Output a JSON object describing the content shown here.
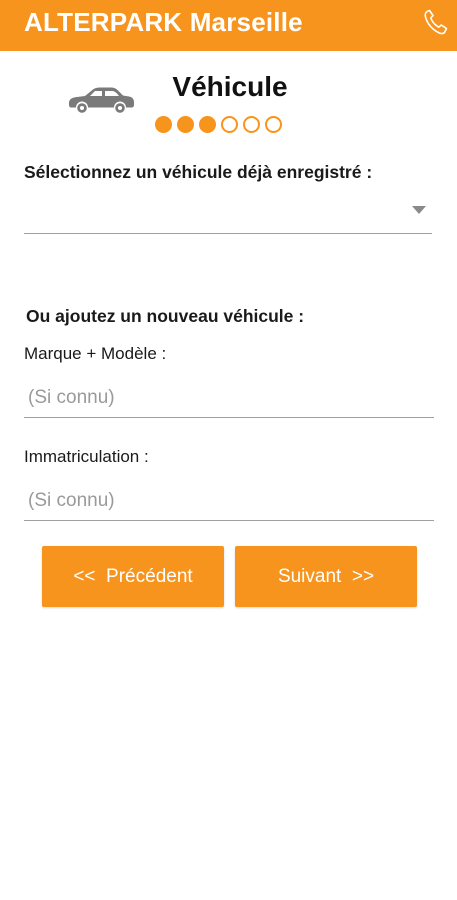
{
  "app": {
    "title": "ALTERPARK Marseille",
    "accent_color": "#f7941d",
    "phone_icon": "phone-icon"
  },
  "step": {
    "icon": "car-icon",
    "title": "Véhicule",
    "current": 3,
    "total": 6
  },
  "existing_vehicle": {
    "label": "Sélectionnez un véhicule déjà enregistré :",
    "selected_value": ""
  },
  "new_vehicle": {
    "heading": "Ou ajoutez un nouveau véhicule :",
    "make_model": {
      "label": "Marque + Modèle :",
      "placeholder": "(Si connu)",
      "value": ""
    },
    "registration": {
      "label": "Immatriculation :",
      "placeholder": "(Si connu)",
      "value": ""
    }
  },
  "navigation": {
    "previous_label": "<<  Précédent",
    "next_label": "Suivant  >>"
  }
}
